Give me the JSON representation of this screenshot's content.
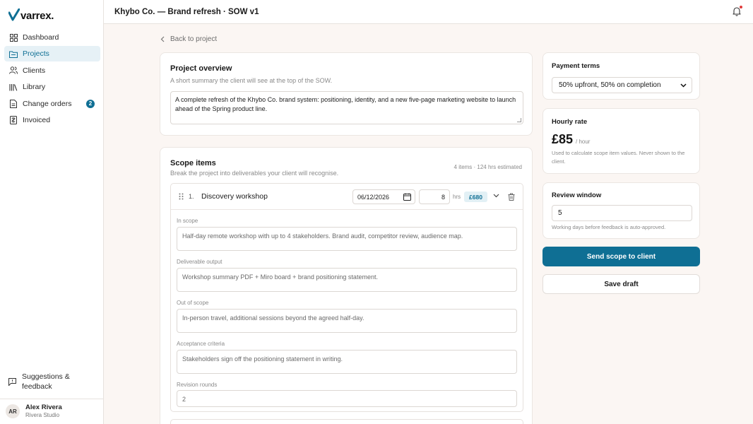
{
  "app": {
    "logo_text": "varrex."
  },
  "sidebar": {
    "items": [
      {
        "label": "Dashboard"
      },
      {
        "label": "Projects"
      },
      {
        "label": "Clients"
      },
      {
        "label": "Library"
      },
      {
        "label": "Change orders",
        "badge": "2"
      },
      {
        "label": "Invoiced"
      }
    ],
    "feedback_label": "Suggestions & feedback",
    "user": {
      "initials": "AR",
      "name": "Alex Rivera",
      "org": "Rivera Studio"
    }
  },
  "header": {
    "title": "Khybo Co. — Brand refresh · SOW v1"
  },
  "main": {
    "back_label": "Back to project",
    "overview": {
      "title": "Project overview",
      "subtitle": "A short summary the client will see at the top of the SOW.",
      "text": "A complete refresh of the Khybo Co. brand system: positioning, identity, and a new five-page marketing website to launch ahead of the Spring product line."
    },
    "scope": {
      "title": "Scope items",
      "subtitle": "Break the project into deliverables your client will recognise.",
      "meta": "4 items · 124 hrs estimated",
      "item": {
        "number": "1.",
        "name": "Discovery workshop",
        "date": "06/12/2026",
        "hours": "8",
        "hours_unit": "hrs",
        "amount": "£680",
        "fields": [
          {
            "label": "In scope",
            "value": "Half-day remote workshop with up to 4 stakeholders. Brand audit, competitor review, audience map."
          },
          {
            "label": "Deliverable output",
            "value": "Workshop summary PDF + Miro board + brand positioning statement."
          },
          {
            "label": "Out of scope",
            "value": "In-person travel, additional sessions beyond the agreed half-day."
          },
          {
            "label": "Acceptance criteria",
            "value": "Stakeholders sign off the positioning statement in writing."
          },
          {
            "label": "Revision rounds",
            "value": "2"
          }
        ]
      }
    }
  },
  "right": {
    "payment": {
      "title": "Payment terms",
      "selected": "50% upfront, 50% on completion"
    },
    "rate": {
      "title": "Hourly rate",
      "value": "£85",
      "unit": "/ hour",
      "note": "Used to calculate scope item values. Never shown to the client."
    },
    "review": {
      "title": "Review window",
      "value": "5",
      "note": "Working days before feedback is auto-approved."
    },
    "send_label": "Send scope to client",
    "draft_label": "Save draft"
  },
  "colors": {
    "accent": "#0f6f94",
    "accent_soft": "#e2f0f5",
    "background": "#fbf6f3",
    "alert": "#e03b3b"
  }
}
